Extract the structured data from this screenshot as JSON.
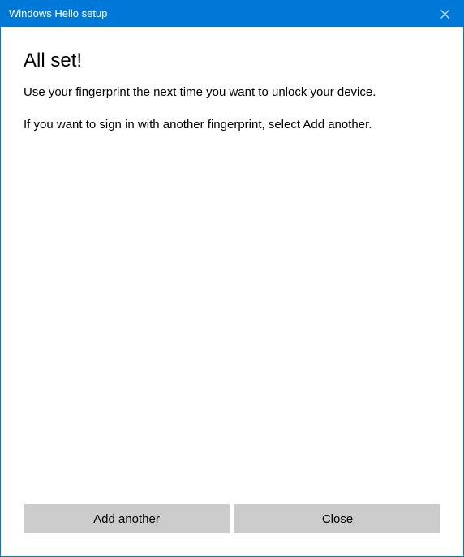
{
  "titlebar": {
    "title": "Windows Hello setup"
  },
  "content": {
    "heading": "All set!",
    "paragraph1": "Use your fingerprint the next time you want to unlock your device.",
    "paragraph2": "If you want to sign in with another fingerprint, select Add another."
  },
  "footer": {
    "add_another_label": "Add another",
    "close_label": "Close"
  }
}
